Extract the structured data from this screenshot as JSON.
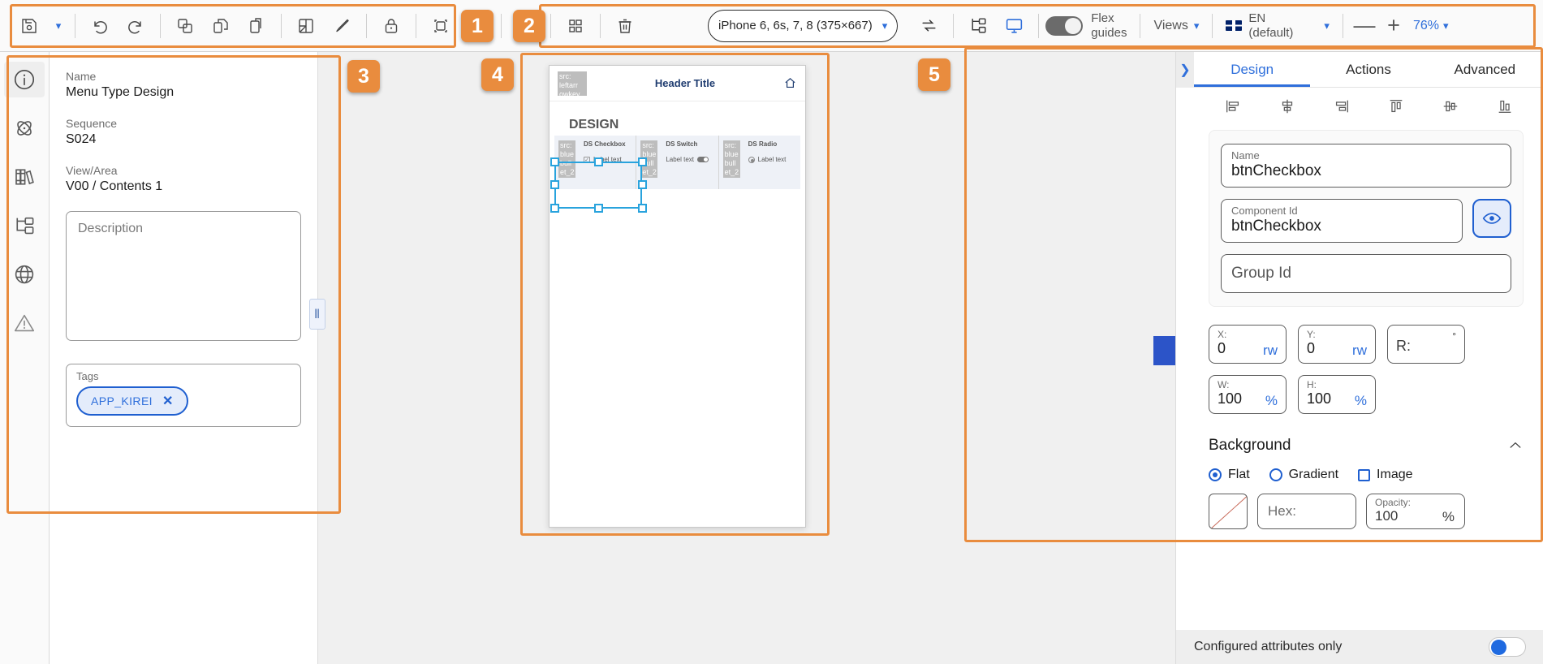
{
  "toolbar": {
    "save_label": "save-icon",
    "undo_label": "undo-icon",
    "redo_label": "redo-icon",
    "device": "iPhone 6, 6s, 7, 8 (375×667)",
    "flex_guides_line1": "Flex",
    "flex_guides_line2": "guides",
    "views_label": "Views",
    "language_line1": "EN",
    "language_line2": "(default)",
    "zoom_minus": "—",
    "zoom_plus": "+",
    "zoom_value": "76%"
  },
  "callouts": {
    "one": "1",
    "two": "2",
    "three": "3",
    "four": "4",
    "five": "5"
  },
  "info_panel": {
    "name_label": "Name",
    "name_value": "Menu Type Design",
    "sequence_label": "Sequence",
    "sequence_value": "S024",
    "view_area_label": "View/Area",
    "view_area_value": "V00 / Contents 1",
    "description_placeholder": "Description",
    "tags_label": "Tags",
    "tag_value": "APP_KIREI",
    "tag_remove": "✕"
  },
  "canvas": {
    "header_title": "Header Title",
    "left_image_placeholder": "src: leftarr owkey",
    "design_heading": "DESIGN",
    "components": [
      {
        "image_placeholder": "src: blue bull et_2",
        "name": "DS Checkbox",
        "control": "checkbox",
        "label": "Label text"
      },
      {
        "image_placeholder": "src: blue bull et_2",
        "name": "DS Switch",
        "control": "switch",
        "label": "Label text"
      },
      {
        "image_placeholder": "src: blue bull et_2",
        "name": "DS Radio",
        "control": "radio",
        "label": "Label text"
      }
    ]
  },
  "properties": {
    "tabs": [
      {
        "label": "Design",
        "active": true
      },
      {
        "label": "Actions",
        "active": false
      },
      {
        "label": "Advanced",
        "active": false
      }
    ],
    "name_label": "Name",
    "name_value": "btnCheckbox",
    "component_id_label": "Component Id",
    "component_id_value": "btnCheckbox",
    "group_id_placeholder": "Group Id",
    "x_label": "X:",
    "x_value": "0",
    "x_unit": "rw",
    "y_label": "Y:",
    "y_value": "0",
    "y_unit": "rw",
    "r_label": "R:",
    "r_unit": "°",
    "w_label": "W:",
    "w_value": "100",
    "w_unit": "%",
    "h_label": "H:",
    "h_value": "100",
    "h_unit": "%",
    "background_title": "Background",
    "bg_flat": "Flat",
    "bg_gradient": "Gradient",
    "bg_image": "Image",
    "hex_placeholder": "Hex:",
    "opacity_label": "Opacity:",
    "opacity_value": "100",
    "opacity_unit": "%",
    "footer_label": "Configured attributes only"
  },
  "colors": {
    "accent_blue": "#2f6fdb",
    "callout_orange": "#e98c3e",
    "selection_blue": "#29a3dd"
  }
}
